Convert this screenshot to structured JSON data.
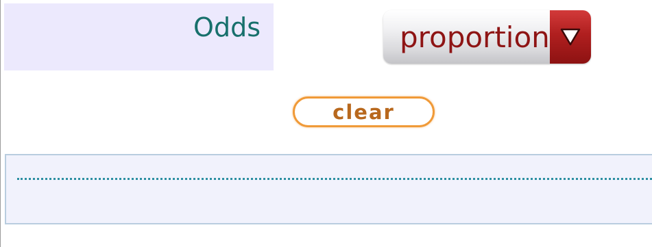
{
  "odds_panel": {
    "label": "Odds"
  },
  "dropdown": {
    "selected_value": "proportion",
    "arrow_icon": "triangle-down-icon"
  },
  "clear_button": {
    "label": "clear"
  },
  "colors": {
    "label_teal": "#17706c",
    "dropdown_text": "#8e1414",
    "dropdown_arrow_red": "#b01f1f",
    "clear_orange": "#f09a38",
    "panel_lavender": "#ece9fd",
    "output_panel_bg": "#f1f2fc",
    "dotted_line_teal": "#2c8fa2"
  }
}
